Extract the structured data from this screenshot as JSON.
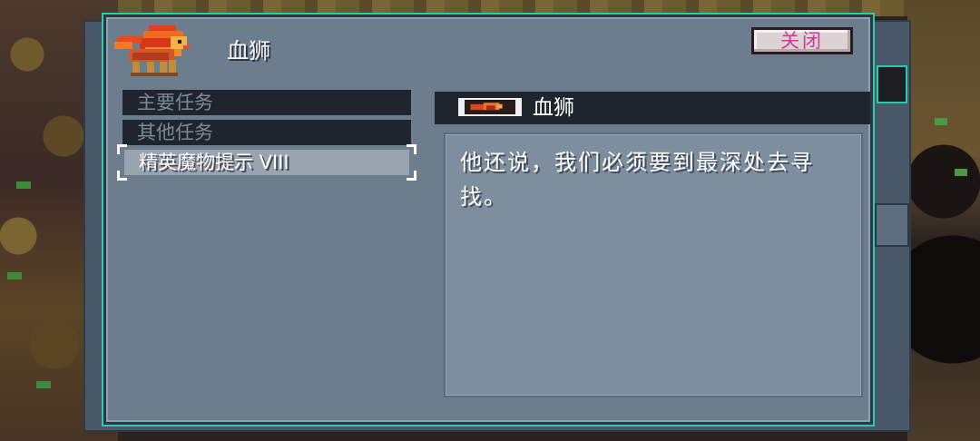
{
  "dialog": {
    "title": "血狮",
    "close_label": "关闭"
  },
  "categories": [
    {
      "label": "主要任务",
      "selected": false
    },
    {
      "label": "其他任务",
      "selected": false
    },
    {
      "label": "精英魔物提示 VIII",
      "selected": true
    }
  ],
  "detail": {
    "title": "血狮",
    "text": "他还说，我们必须要到最深处去寻找。"
  },
  "colors": {
    "panel": "#6c7d8e",
    "frame_accent": "#2cc8b0",
    "close_text": "#d0389a",
    "list_bg": "#1f252c",
    "selected_bg": "#9aa4ae"
  },
  "icons": [
    "blood-lion-portrait-icon",
    "blood-lion-thumb-icon"
  ]
}
